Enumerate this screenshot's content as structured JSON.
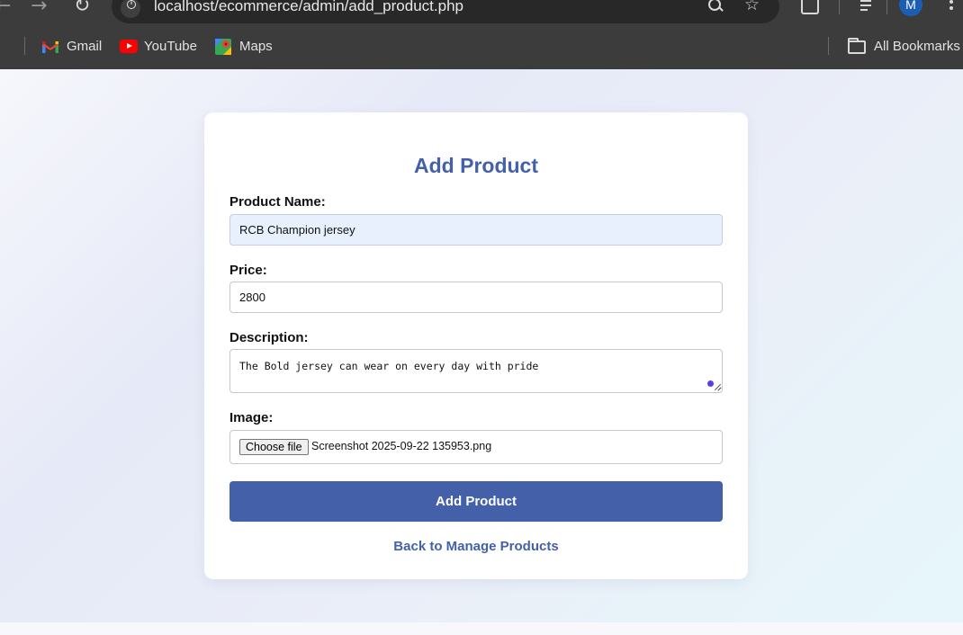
{
  "browser": {
    "url": "localhost/ecommerce/admin/add_product.php",
    "icons": [
      "back-icon",
      "forward-icon",
      "reload-icon",
      "site-info-icon",
      "zoom-icon",
      "bookmark-star-icon",
      "extensions-icon",
      "media-icon",
      "menu-icon"
    ],
    "profile_initial": "M",
    "profile_color": "#1a5fb4"
  },
  "bookmarks": {
    "items": [
      {
        "label": "Gmail",
        "icon": "gmail-icon"
      },
      {
        "label": "YouTube",
        "icon": "youtube-icon"
      },
      {
        "label": "Maps",
        "icon": "maps-icon"
      }
    ],
    "all_bookmarks_label": "All Bookmarks"
  },
  "form": {
    "title": "Add Product",
    "fields": {
      "name_label": "Product Name:",
      "name_value": "RCB Champion jersey",
      "price_label": "Price:",
      "price_value": "2800",
      "description_label": "Description:",
      "description_value": "The Bold jersey can wear on every day with pride",
      "image_label": "Image:",
      "choose_file_label": "Choose file",
      "file_name": "Screenshot 2025-09-22 135953.png"
    },
    "submit_label": "Add Product",
    "back_link_label": "Back to Manage Products"
  },
  "colors": {
    "accent": "#4460a9",
    "autofill_background": "#e8f0fe",
    "chrome_background": "#3c3c3c"
  }
}
